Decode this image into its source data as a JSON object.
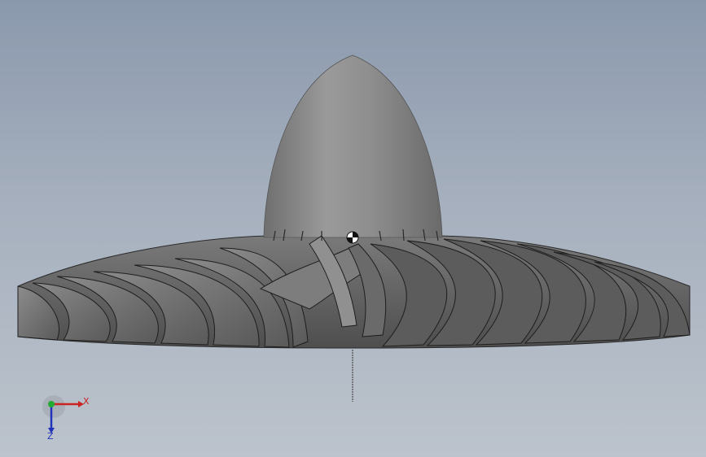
{
  "viewport": {
    "background_top": "#8b99ad",
    "background_bottom": "#bcc3cc"
  },
  "model": {
    "type": "impeller",
    "hub_color": "#8a8a8a",
    "blade_color": "#6e6e6e",
    "blade_edge_color": "#1e1e1e"
  },
  "triad": {
    "x_label": "X",
    "z_label": "Z",
    "x_color": "#cc2222",
    "y_color": "#22aa33",
    "z_color": "#2233bb"
  },
  "center_of_mass": {
    "icon": "center-of-mass-icon"
  }
}
